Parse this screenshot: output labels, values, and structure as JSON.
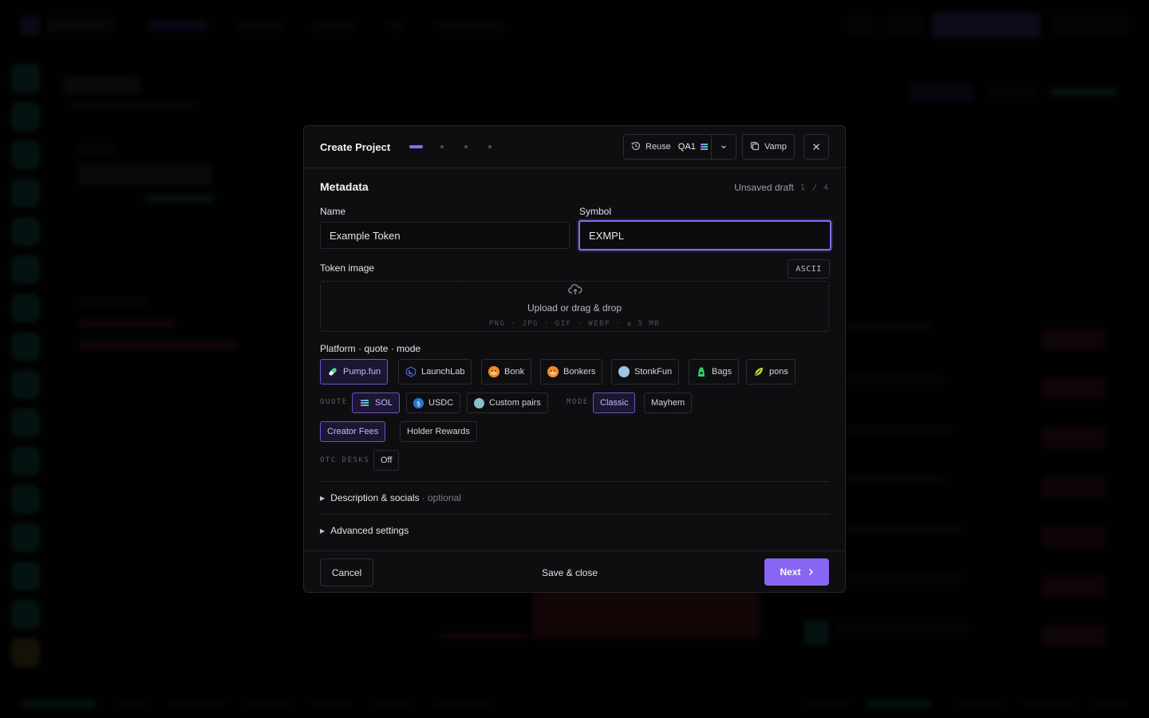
{
  "modal": {
    "title": "Create Project",
    "steps": 4,
    "current_step": 1,
    "reuse": {
      "label": "Reuse",
      "profile": "QA1"
    },
    "vamp_label": "Vamp",
    "section_title": "Metadata",
    "draft_status": "Unsaved draft",
    "page_current": "1",
    "page_sep": "/",
    "page_total": "4",
    "name": {
      "label": "Name",
      "value": "Example Token"
    },
    "symbol": {
      "label": "Symbol",
      "value": "EXMPL"
    },
    "token_image": {
      "label": "Token image",
      "ascii_button": "ASCII",
      "upload_text": "Upload or drag & drop",
      "formats": "PNG · JPG · GIF · WEBP · ≤ 5 MB"
    },
    "platform_section_label": "Platform · quote · mode",
    "platforms": [
      {
        "label": "Pump.fun",
        "selected": true,
        "color": "#3ee08a"
      },
      {
        "label": "LaunchLab",
        "selected": false,
        "color": "#3b4cc0"
      },
      {
        "label": "Bonk",
        "selected": false,
        "color": "#f08a24"
      },
      {
        "label": "Bonkers",
        "selected": false,
        "color": "#f08a24"
      },
      {
        "label": "StonkFun",
        "selected": false,
        "color": "#9ec6e6"
      },
      {
        "label": "Bags",
        "selected": false,
        "color": "#2fd16a"
      },
      {
        "label": "pons",
        "selected": false,
        "color": "#b6e02a"
      }
    ],
    "quote_tag": "QUOTE",
    "quotes": [
      {
        "label": "SOL",
        "selected": true
      },
      {
        "label": "USDC",
        "selected": false
      },
      {
        "label": "Custom pairs",
        "selected": false
      }
    ],
    "mode_tag": "MODE",
    "modes": [
      {
        "label": "Classic",
        "selected": true
      },
      {
        "label": "Mayhem",
        "selected": false
      }
    ],
    "fees": [
      {
        "label": "Creator Fees",
        "selected": true
      },
      {
        "label": "Holder Rewards",
        "selected": false
      }
    ],
    "otc_tag": "OTC DESKS",
    "otc_value": "Off",
    "description_section": {
      "label": "Description & socials",
      "optional": "· optional"
    },
    "advanced_section": {
      "label": "Advanced settings"
    },
    "footer": {
      "cancel": "Cancel",
      "save_close": "Save & close",
      "next": "Next"
    },
    "colors": {
      "accent": "#8a66f4",
      "focus_ring": "#8b6cf6"
    }
  }
}
